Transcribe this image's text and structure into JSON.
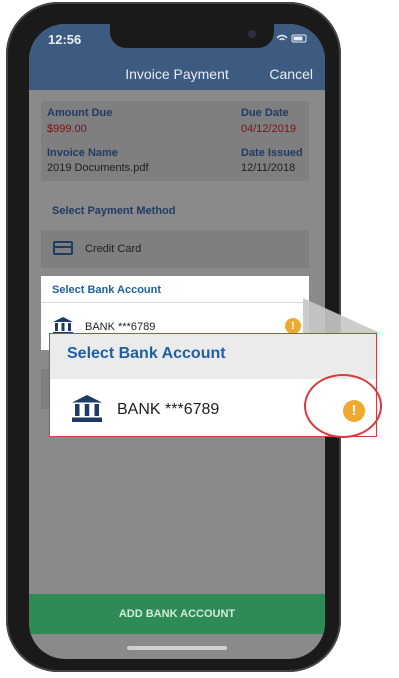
{
  "status_bar": {
    "time": "12:56",
    "indicators": "wifi-icon battery-icon"
  },
  "header": {
    "title": "Invoice Payment",
    "cancel_label": "Cancel"
  },
  "invoice": {
    "amount_due_label": "Amount Due",
    "amount_due_value": "$999.00",
    "due_date_label": "Due Date",
    "due_date_value": "04/12/2019",
    "invoice_name_label": "Invoice Name",
    "invoice_name_value": "2019 Documents.pdf",
    "date_issued_label": "Date Issued",
    "date_issued_value": "12/11/2018"
  },
  "payment_method": {
    "section_label": "Select Payment Method",
    "credit_card_label": "Credit Card"
  },
  "bank_panel": {
    "title": "Select Bank Account",
    "account_label": "BANK ***6789",
    "alert_symbol": "!"
  },
  "callout": {
    "title": "Select Bank Account",
    "account_label": "BANK ***6789",
    "alert_symbol": "!"
  },
  "footer": {
    "add_bank_label": "ADD BANK ACCOUNT"
  },
  "colors": {
    "header": "#3d5a80",
    "accent_blue": "#1f5fa3",
    "alert": "#f0a830",
    "highlight": "#d93a3a",
    "button_green": "#2e8b57"
  }
}
